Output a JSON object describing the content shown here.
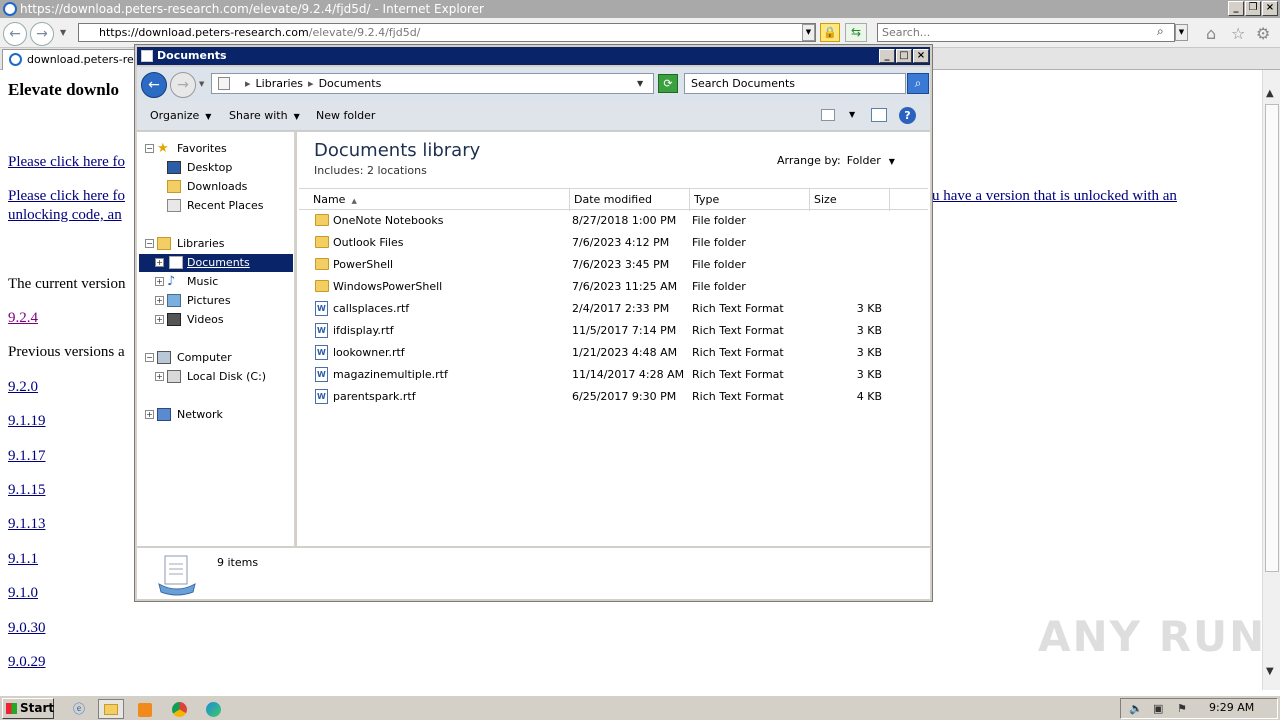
{
  "ie": {
    "title": "https://download.peters-research.com/elevate/9.2.4/fjd5d/ - Internet Explorer",
    "address_domain": "https://download.peters-research.com",
    "address_path": "/elevate/9.2.4/fjd5d/",
    "search_placeholder": "Search...",
    "tab_label": "download.peters-rese..."
  },
  "page": {
    "heading": "Elevate downlo",
    "link1": "Please click here fo",
    "link2_line1": "Please click here fo",
    "link2_tail": "u have a version that is unlocked with an",
    "link2_line2": "unlocking code, an",
    "current_version_text": "The current version",
    "current_version": "9.2.4",
    "previous_text": "Previous versions a",
    "previous_versions": [
      "9.2.0",
      "9.1.19",
      "9.1.17",
      "9.1.15",
      "9.1.13",
      "9.1.1",
      "9.1.0",
      "9.0.30",
      "9.0.29"
    ]
  },
  "explorer": {
    "title": "Documents",
    "breadcrumb": [
      "Libraries",
      "Documents"
    ],
    "search_placeholder": "Search Documents",
    "toolbar": {
      "organize": "Organize",
      "share": "Share with",
      "new_folder": "New folder"
    },
    "tree": {
      "favorites": "Favorites",
      "desktop": "Desktop",
      "downloads": "Downloads",
      "recent": "Recent Places",
      "libraries": "Libraries",
      "documents": "Documents",
      "music": "Music",
      "pictures": "Pictures",
      "videos": "Videos",
      "computer": "Computer",
      "local_disk": "Local Disk (C:)",
      "network": "Network"
    },
    "library_title": "Documents library",
    "library_includes": "Includes:  2 locations",
    "arrange_label": "Arrange by:",
    "arrange_value": "Folder",
    "columns": {
      "name": "Name",
      "date": "Date modified",
      "type": "Type",
      "size": "Size"
    },
    "files": [
      {
        "name": "OneNote Notebooks",
        "date": "8/27/2018 1:00 PM",
        "type": "File folder",
        "size": "",
        "kind": "folder"
      },
      {
        "name": "Outlook Files",
        "date": "7/6/2023 4:12 PM",
        "type": "File folder",
        "size": "",
        "kind": "folder"
      },
      {
        "name": "PowerShell",
        "date": "7/6/2023 3:45 PM",
        "type": "File folder",
        "size": "",
        "kind": "folder"
      },
      {
        "name": "WindowsPowerShell",
        "date": "7/6/2023 11:25 AM",
        "type": "File folder",
        "size": "",
        "kind": "folder"
      },
      {
        "name": "callsplaces.rtf",
        "date": "2/4/2017 2:33 PM",
        "type": "Rich Text Format",
        "size": "3 KB",
        "kind": "rtf"
      },
      {
        "name": "ifdisplay.rtf",
        "date": "11/5/2017 7:14 PM",
        "type": "Rich Text Format",
        "size": "3 KB",
        "kind": "rtf"
      },
      {
        "name": "lookowner.rtf",
        "date": "1/21/2023 4:48 AM",
        "type": "Rich Text Format",
        "size": "3 KB",
        "kind": "rtf"
      },
      {
        "name": "magazinemultiple.rtf",
        "date": "11/14/2017 4:28 AM",
        "type": "Rich Text Format",
        "size": "3 KB",
        "kind": "rtf"
      },
      {
        "name": "parentspark.rtf",
        "date": "6/25/2017 9:30 PM",
        "type": "Rich Text Format",
        "size": "4 KB",
        "kind": "rtf"
      }
    ],
    "status_text": "9 items"
  },
  "taskbar": {
    "start_label": "Start",
    "clock": "9:29 AM"
  },
  "watermark": "ANY RUN"
}
